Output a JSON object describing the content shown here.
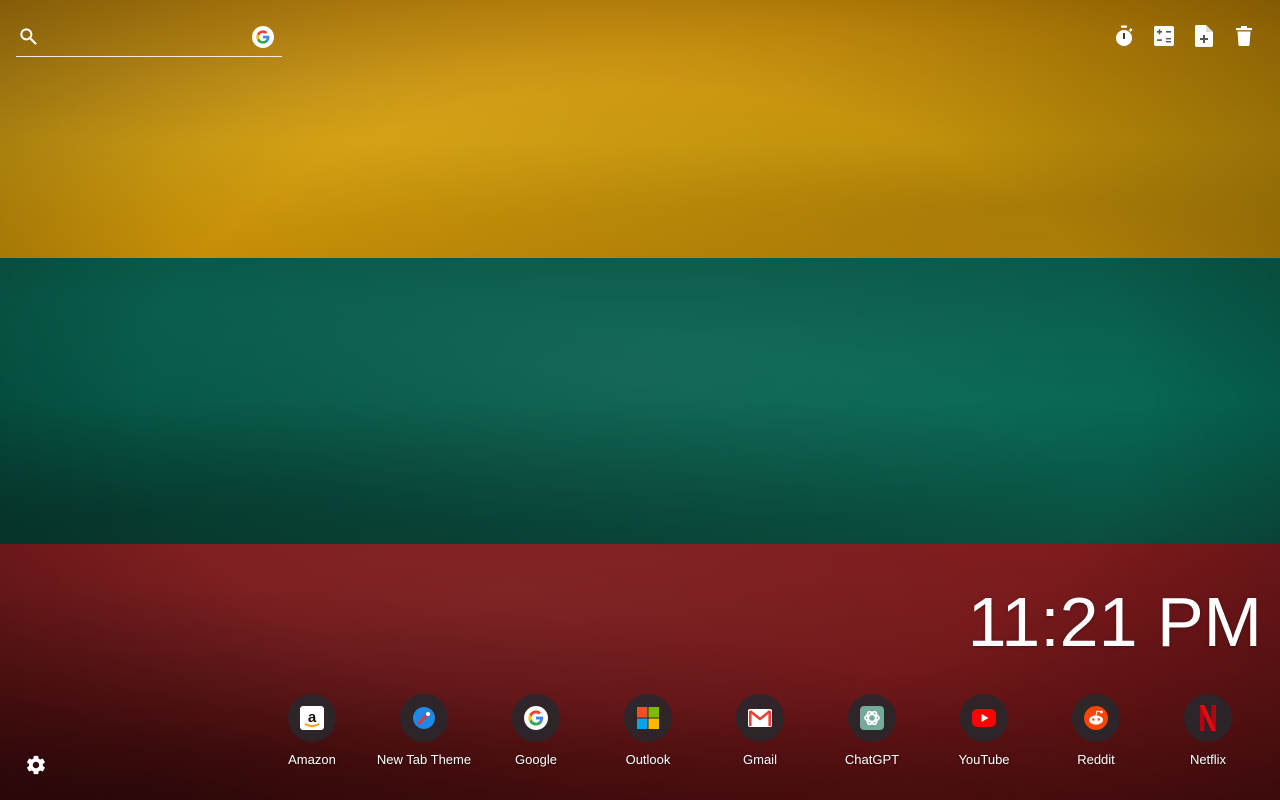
{
  "background": {
    "stripe_colors": [
      "#d19a08",
      "#066652",
      "#701618"
    ]
  },
  "search": {
    "placeholder": "",
    "value": "",
    "icon": "search-icon",
    "engine_icon": "google-g-icon"
  },
  "toolbar": [
    {
      "icon": "stopwatch-icon"
    },
    {
      "icon": "calculator-icon"
    },
    {
      "icon": "add-note-icon"
    },
    {
      "icon": "trash-icon"
    }
  ],
  "clock": {
    "time": "11:21 PM"
  },
  "shortcuts": [
    {
      "label": "Amazon",
      "icon": "amazon-icon"
    },
    {
      "label": "New Tab Theme",
      "icon": "new-tab-theme-icon"
    },
    {
      "label": "Google",
      "icon": "google-icon"
    },
    {
      "label": "Outlook",
      "icon": "outlook-icon"
    },
    {
      "label": "Gmail",
      "icon": "gmail-icon"
    },
    {
      "label": "ChatGPT",
      "icon": "chatgpt-icon"
    },
    {
      "label": "YouTube",
      "icon": "youtube-icon"
    },
    {
      "label": "Reddit",
      "icon": "reddit-icon"
    },
    {
      "label": "Netflix",
      "icon": "netflix-icon"
    }
  ],
  "settings": {
    "icon": "gear-icon"
  }
}
